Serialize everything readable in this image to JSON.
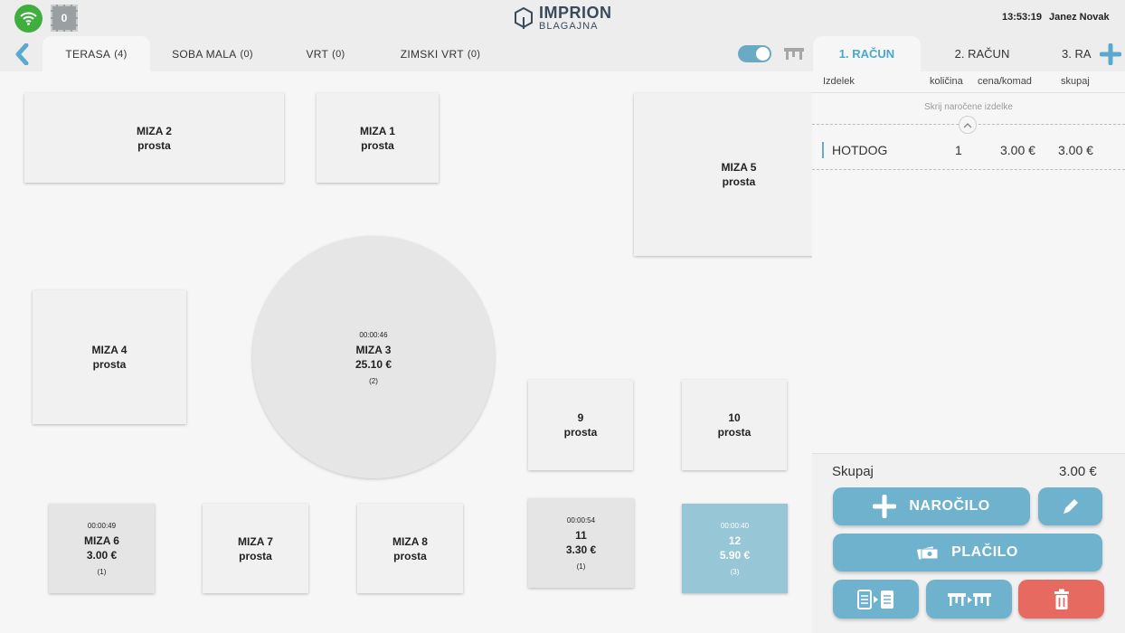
{
  "status": {
    "wifi_icon": "wifi-icon",
    "badge_count": "0"
  },
  "logo": {
    "name": "IMPRION",
    "sub": "BLAGAJNA"
  },
  "header": {
    "time": "13:53:19",
    "user": "Janez Novak"
  },
  "rooms": [
    {
      "label": "TERASA",
      "count": "(4)"
    },
    {
      "label": "SOBA MALA",
      "count": "(0)"
    },
    {
      "label": "VRT",
      "count": "(0)"
    },
    {
      "label": "ZIMSKI VRT",
      "count": "(0)"
    }
  ],
  "tables": [
    {
      "name": "MIZA 2",
      "status": "prosta"
    },
    {
      "name": "MIZA 1",
      "status": "prosta"
    },
    {
      "name": "MIZA 5",
      "status": "prosta"
    },
    {
      "name": "MIZA 4",
      "status": "prosta"
    },
    {
      "name": "MIZA 3",
      "time": "00:00:46",
      "amount": "25.10 €",
      "guests": "(2)"
    },
    {
      "name": "9",
      "status": "prosta"
    },
    {
      "name": "10",
      "status": "prosta"
    },
    {
      "name": "MIZA 6",
      "time": "00:00:49",
      "amount": "3.00 €",
      "guests": "(1)"
    },
    {
      "name": "MIZA 7",
      "status": "prosta"
    },
    {
      "name": "MIZA 8",
      "status": "prosta"
    },
    {
      "name": "11",
      "time": "00:00:54",
      "amount": "3.30 €",
      "guests": "(1)"
    },
    {
      "name": "12",
      "time": "00:00:40",
      "amount": "5.90 €",
      "guests": "(3)"
    }
  ],
  "bills": {
    "tabs": [
      "1. RAČUN",
      "2. RAČUN",
      "3. RA"
    ]
  },
  "columns": {
    "item": "Izdelek",
    "qty": "količina",
    "price": "cena/komad",
    "total": "skupaj"
  },
  "order": {
    "hide_ordered": "Skrij naročene izdelke",
    "items": [
      {
        "name": "HOTDOG",
        "qty": "1",
        "price": "3.00 €",
        "total": "3.00 €"
      }
    ]
  },
  "summary": {
    "label": "Skupaj",
    "value": "3.00 €"
  },
  "actions": {
    "order": "NAROČILO",
    "payment": "PLAČILO"
  },
  "colors": {
    "accent": "#6fb2cd",
    "selected_table": "#97c6d7",
    "danger": "#e66a60",
    "wifi": "#3fae3f"
  }
}
